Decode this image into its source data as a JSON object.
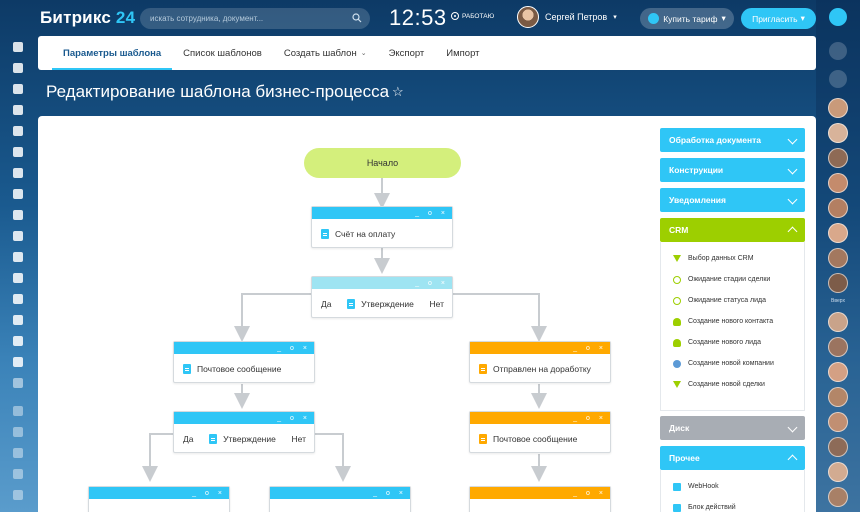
{
  "app": {
    "logo_main": "Битрикс",
    "logo_accent": "24",
    "search_placeholder": "искать сотрудника, документ...",
    "clock": "12:53",
    "work_status": "РАБОТАЮ",
    "user_name": "Сергей Петров",
    "buy_label": "Купить тариф",
    "invite_label": "Пригласить"
  },
  "tabs": [
    {
      "label": "Параметры шаблона",
      "active": true
    },
    {
      "label": "Список шаблонов"
    },
    {
      "label": "Создать шаблон"
    },
    {
      "label": "Экспорт"
    },
    {
      "label": "Импорт"
    }
  ],
  "page": {
    "title": "Редактирование шаблона бизнес-процесса"
  },
  "flow": {
    "start": "Начало",
    "invoice": "Счёт на оплату",
    "approval1": "Утверждение",
    "yes": "Да",
    "no": "Нет",
    "mail_left": "Почтовое сообщение",
    "returned": "Отправлен на доработку",
    "approval2": "Утверждение",
    "mail_right": "Почтовое сообщение",
    "block_controls": [
      "_",
      "o",
      "×"
    ]
  },
  "panel": {
    "sections": [
      {
        "label": "Обработка документа",
        "color": "#2fc6f6",
        "expanded": false
      },
      {
        "label": "Конструкции",
        "color": "#2fc6f6",
        "expanded": false
      },
      {
        "label": "Уведомления",
        "color": "#2fc6f6",
        "expanded": false
      },
      {
        "label": "CRM",
        "color": "#9dcf00",
        "expanded": true
      },
      {
        "label": "Диск",
        "color": "#a8adb4",
        "expanded": false
      },
      {
        "label": "Прочее",
        "color": "#2fc6f6",
        "expanded": true
      }
    ],
    "crm_items": [
      {
        "label": "Выбор данных CRM",
        "icon": "filter-icon"
      },
      {
        "label": "Ожидание стадии сделки",
        "icon": "clock-icon"
      },
      {
        "label": "Ожидание статуса лида",
        "icon": "clock-icon"
      },
      {
        "label": "Создание нового контакта",
        "icon": "user-icon"
      },
      {
        "label": "Создание нового лида",
        "icon": "user-icon"
      },
      {
        "label": "Создание новой компании",
        "icon": "group-icon"
      },
      {
        "label": "Создание новой сделки",
        "icon": "filter-icon"
      }
    ],
    "other_items": [
      {
        "label": "WebHook",
        "icon": "doc-icon"
      },
      {
        "label": "Блок действий",
        "icon": "doc-icon"
      }
    ]
  },
  "rail": {
    "online_label": "Вверх"
  },
  "colors": {
    "accent": "#2fc6f6",
    "crm": "#9dcf00",
    "start": "#d4ef7c",
    "orange": "#ffa900"
  }
}
